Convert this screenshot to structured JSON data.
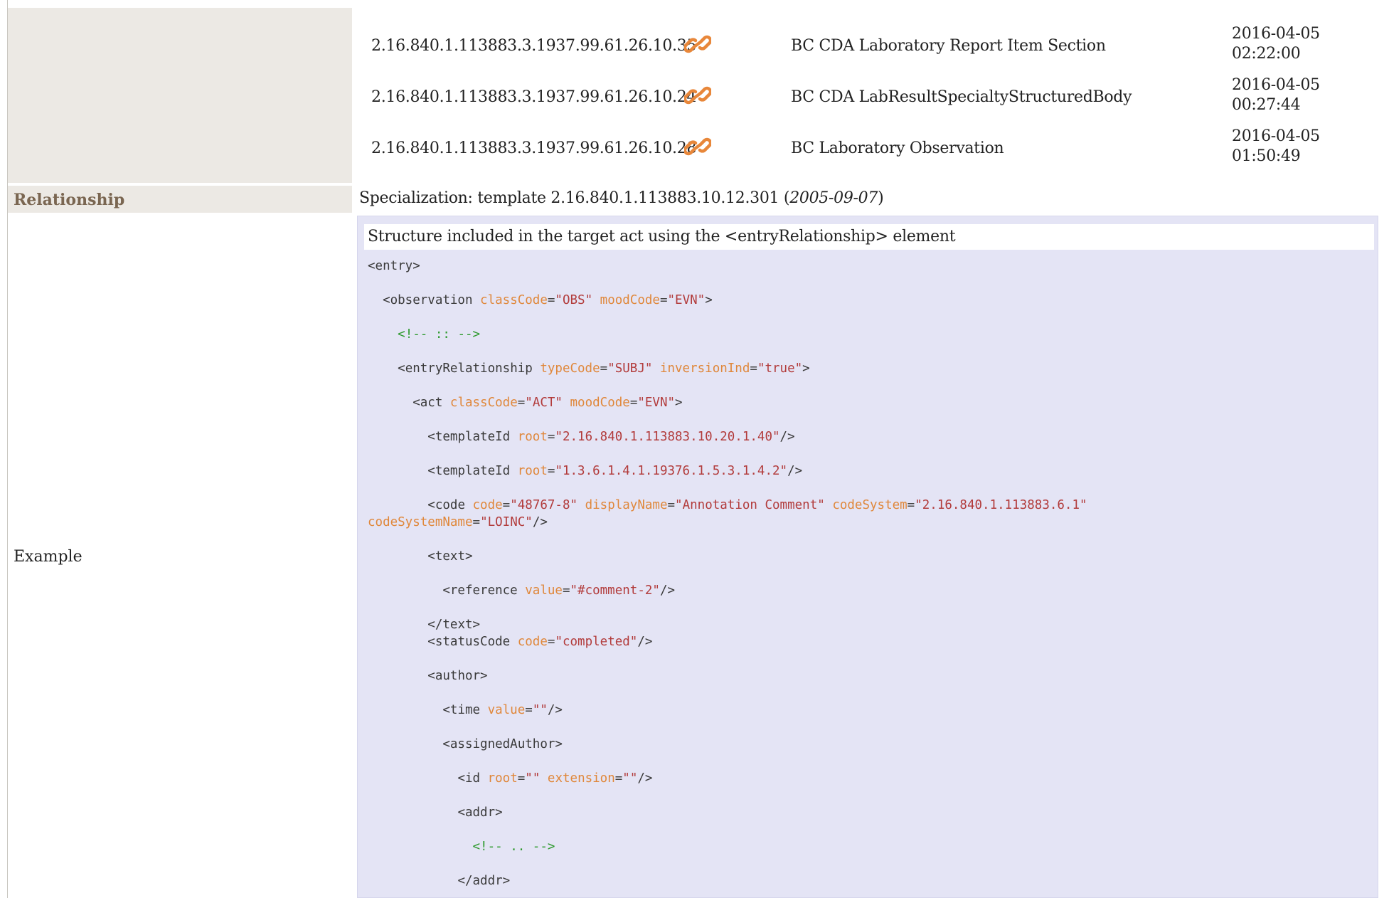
{
  "used_by": [
    {
      "oid": "2.16.840.1.113883.3.1937.99.61.26.10.35",
      "name": "BC CDA Laboratory Report Item Section",
      "date_line1": "2016-04-05",
      "date_line2": "02:22:00"
    },
    {
      "oid": "2.16.840.1.113883.3.1937.99.61.26.10.24",
      "name": "BC CDA LabResultSpecialtyStructuredBody",
      "date_line1": "2016-04-05",
      "date_line2": "00:27:44"
    },
    {
      "oid": "2.16.840.1.113883.3.1937.99.61.26.10.28",
      "name": "BC Laboratory Observation",
      "date_line1": "2016-04-05",
      "date_line2": "01:50:49"
    }
  ],
  "relationship": {
    "label": "Relationship",
    "prefix": "Specialization: template 2.16.840.1.113883.10.12.301 (",
    "date": "2005-09-07",
    "suffix": ")"
  },
  "example": {
    "label": "Example",
    "caption": "Structure included in the target act using the <entryRelationship> element"
  },
  "colors": {
    "link_icon": "#e8873a",
    "label_bg": "#ece9e4",
    "example_bg": "#e4e4f5"
  }
}
